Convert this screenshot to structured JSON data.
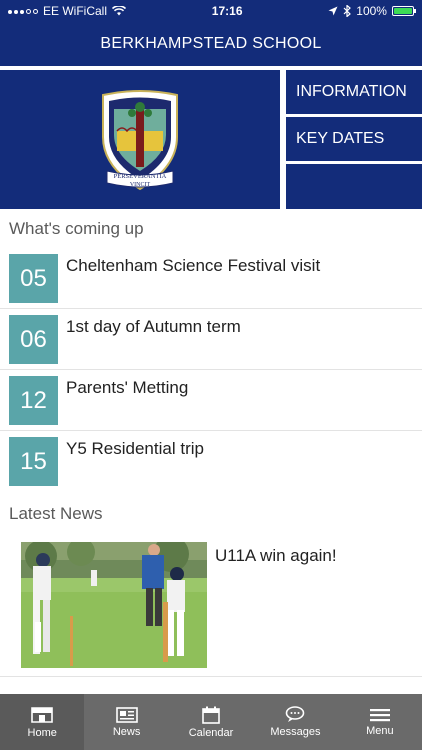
{
  "status_bar": {
    "carrier": "EE WiFiCall",
    "time": "17:16",
    "battery": "100%",
    "battery_color": "#3ddc55"
  },
  "header": {
    "title": "BERKHAMPSTEAD SCHOOL",
    "logo_text_line1": "PERSEVERANTIA",
    "logo_text_line2": "VINCIT",
    "tiles": [
      "INFORMATION",
      "KEY DATES",
      ""
    ]
  },
  "upcoming": {
    "title": "What's coming up",
    "events": [
      {
        "date": "05",
        "title": "Cheltenham Science Festival visit"
      },
      {
        "date": "06",
        "title": "1st day of Autumn term"
      },
      {
        "date": "12",
        "title": "Parents' Metting"
      },
      {
        "date": "15",
        "title": "Y5 Residential trip"
      }
    ]
  },
  "news": {
    "title": "Latest News",
    "items": [
      {
        "title": "U11A win again!",
        "image": "cricket-match-photo"
      }
    ]
  },
  "tabbar": {
    "items": [
      {
        "label": "Home",
        "icon": "home-icon"
      },
      {
        "label": "News",
        "icon": "news-icon"
      },
      {
        "label": "Calendar",
        "icon": "calendar-icon"
      },
      {
        "label": "Messages",
        "icon": "messages-icon"
      },
      {
        "label": "Menu",
        "icon": "menu-icon"
      }
    ]
  },
  "colors": {
    "brand_navy": "#132c7a",
    "date_teal": "#5aa5a9",
    "tabbar_gray": "#6a6a6a"
  }
}
